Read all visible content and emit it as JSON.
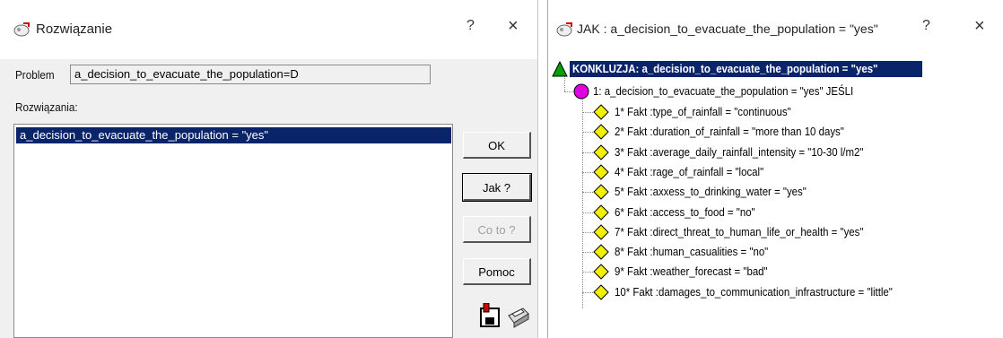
{
  "window1": {
    "title": "Rozwiązanie",
    "help_btn": "?",
    "close_btn": "×",
    "problem_label": "Problem",
    "problem_value": "a_decision_to_evacuate_the_population=D",
    "solutions_label": "Rozwiązania:",
    "solutions": [
      "a_decision_to_evacuate_the_population = \"yes\""
    ],
    "buttons": {
      "ok": "OK",
      "jak": "Jak ?",
      "coto": "Co to ?",
      "pomoc": "Pomoc"
    }
  },
  "window2": {
    "title": "JAK : a_decision_to_evacuate_the_population = \"yes\"",
    "help_btn": "?",
    "close_btn": "×",
    "conclusion": "KONKLUZJA: a_decision_to_evacuate_the_population = \"yes\"",
    "rule": "1: a_decision_to_evacuate_the_population = \"yes\" JEŚLI",
    "facts": [
      "1* Fakt :type_of_rainfall = \"continuous\"",
      "2* Fakt :duration_of_rainfall = \"more than 10 days\"",
      "3* Fakt :average_daily_rainfall_intensity = \"10-30 l/m2\"",
      "4* Fakt :rage_of_rainfall = \"local\"",
      "5* Fakt :axxess_to_drinking_water = \"yes\"",
      "6* Fakt :access_to_food = \"no\"",
      "7* Fakt :direct_threat_to_human_life_or_health = \"yes\"",
      "8* Fakt :human_casualities = \"no\"",
      "9* Fakt :weather_forecast = \"bad\"",
      "10* Fakt :damages_to_communication_infrastructure = \"little\""
    ]
  },
  "colors": {
    "selection": "#0a246a",
    "conclusion_icon": "#00a000",
    "rule_icon": "#e000e0",
    "fact_icon": "#f0f000"
  }
}
